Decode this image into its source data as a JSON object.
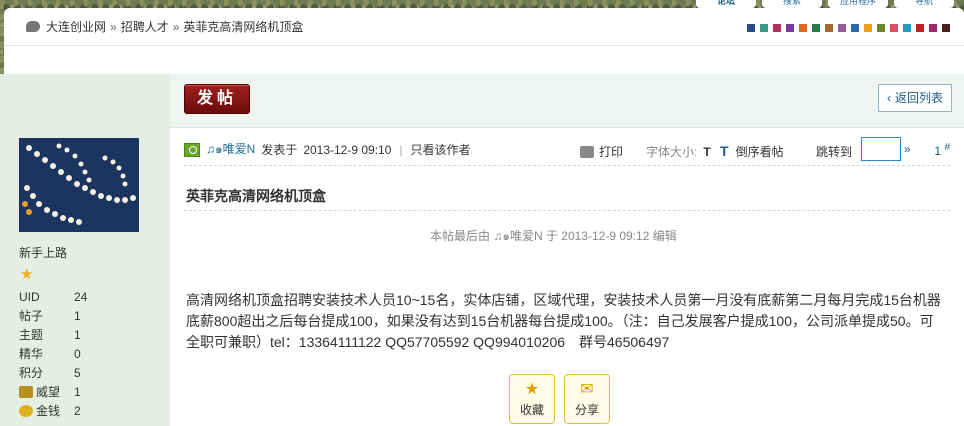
{
  "breadcrumb": {
    "items": [
      "大连创业网",
      "招聘人才",
      "英菲克高清网络机顶盒"
    ],
    "separator": "»"
  },
  "topnav": [
    "论坛",
    "搜索",
    "应用程序",
    "导航"
  ],
  "theme_swatches": [
    "#2a4a8a",
    "#3a9a8a",
    "#b03060",
    "#7a3a9a",
    "#e06a20",
    "#2a7a4a",
    "#a8682a",
    "#9a5aa0",
    "#2a6aa8",
    "#f0a020",
    "#6a8a2a",
    "#e04a6a",
    "#20a0c0",
    "#c02020",
    "#a02a6a",
    "#4a2020"
  ],
  "toolbar": {
    "post_button": "发帖",
    "back_button": "返回列表"
  },
  "user": {
    "name": "新手上路",
    "stats": [
      {
        "label": "UID",
        "value": "24"
      },
      {
        "label": "帖子",
        "value": "1"
      },
      {
        "label": "主题",
        "value": "1"
      },
      {
        "label": "精华",
        "value": "0"
      },
      {
        "label": "积分",
        "value": "5"
      },
      {
        "label": "威望",
        "value": "1",
        "icon": "prestige-icon"
      },
      {
        "label": "金钱",
        "value": "2",
        "icon": "money-icon"
      }
    ]
  },
  "post": {
    "author": "♫๑唯爱N",
    "posted_prefix": "发表于",
    "posted_time": "2013-12-9 09:10",
    "only_author": "只看该作者",
    "print": "打印",
    "font_size_label": "字体大小:",
    "font_size_value": "T",
    "reverse": "倒序看帖",
    "jump_label": "跳转到",
    "jump_arrow": "»",
    "floor": "1",
    "floor_mark": "#",
    "title": "英菲克高清网络机顶盒",
    "edited_note": "本帖最后由 ♫๑唯爱N 于 2013-12-9 09:12 编辑",
    "content": "高清网络机顶盒招聘安装技术人员10~15名，实体店铺，区域代理，安装技术人员第一月没有底薪第二月每月完成15台机器底薪800超出之后每台提成100，如果没有达到15台机器每台提成100。（注：自己发展客户提成100，公司派单提成50。可全职可兼职）tel：13364111122 QQ57705592 QQ994010206　群号46506497",
    "favorite": "收藏",
    "share": "分享"
  }
}
